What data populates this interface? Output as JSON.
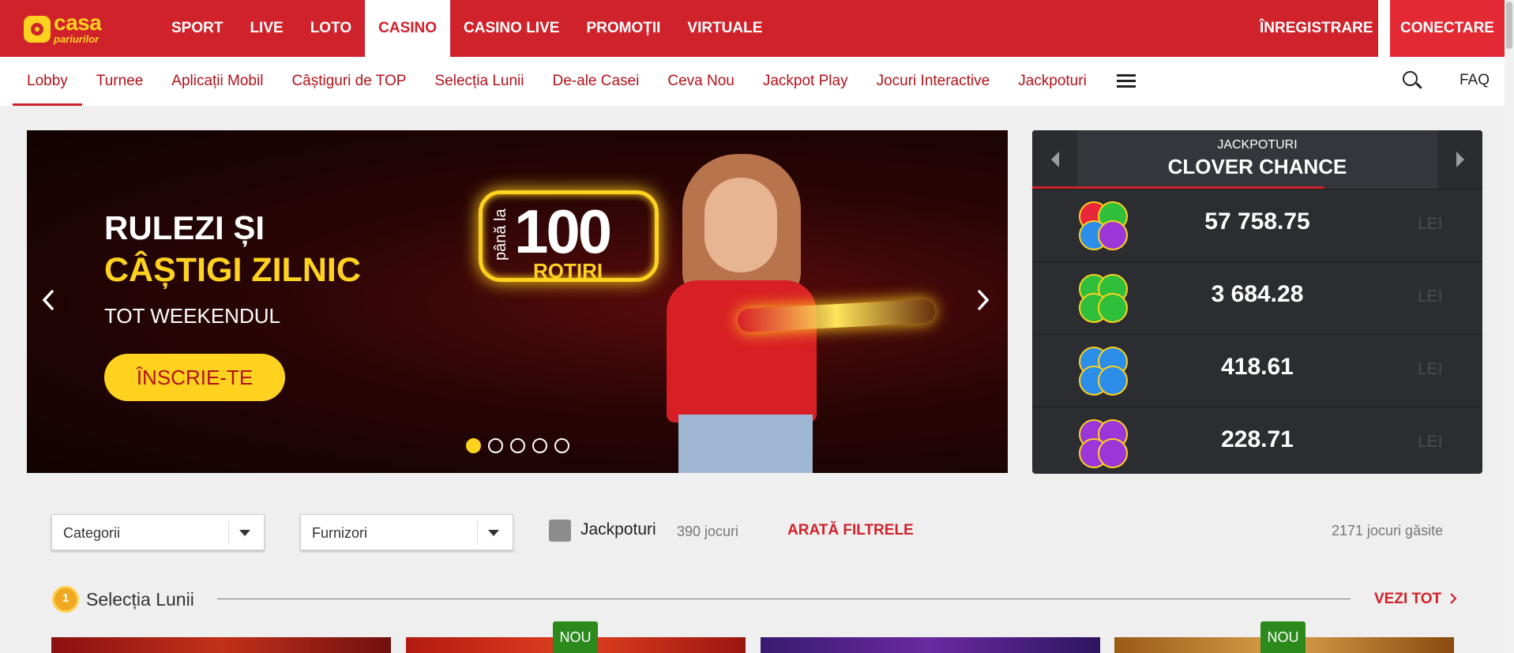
{
  "brand": {
    "logo_text": "casa",
    "logo_sub": "pariurilor"
  },
  "topnav": {
    "items": [
      {
        "label": "SPORT",
        "active": false
      },
      {
        "label": "LIVE",
        "active": false
      },
      {
        "label": "LOTO",
        "active": false
      },
      {
        "label": "CASINO",
        "active": true
      },
      {
        "label": "CASINO LIVE",
        "active": false
      },
      {
        "label": "PROMOȚII",
        "active": false
      },
      {
        "label": "VIRTUALE",
        "active": false
      }
    ],
    "register": "ÎNREGISTRARE",
    "connect": "CONECTARE"
  },
  "subnav": {
    "items": [
      {
        "label": "Lobby",
        "active": true
      },
      {
        "label": "Turnee",
        "active": false
      },
      {
        "label": "Aplicații Mobil",
        "active": false
      },
      {
        "label": "Câștiguri de TOP",
        "active": false
      },
      {
        "label": "Selecția Lunii",
        "active": false
      },
      {
        "label": "De-ale Casei",
        "active": false
      },
      {
        "label": "Ceva Nou",
        "active": false
      },
      {
        "label": "Jackpot Play",
        "active": false
      },
      {
        "label": "Jocuri Interactive",
        "active": false
      },
      {
        "label": "Jackpoturi",
        "active": false
      }
    ],
    "menu_icon": "hamburger-icon",
    "search_icon": "search-icon",
    "faq": "FAQ"
  },
  "hero": {
    "line1": "RULEZI ȘI",
    "line2": "CÂȘTIGI ZILNIC",
    "line3": "TOT WEEKENDUL",
    "cta": "ÎNSCRIE-TE",
    "promo_prefix": "până la",
    "promo_number": "100",
    "promo_unit": "ROTIRI",
    "slides_total": 5,
    "active_slide": 1
  },
  "jackpot": {
    "label": "JACKPOTURI",
    "title": "CLOVER CHANCE",
    "currency": "LEI",
    "tiers": [
      {
        "amount": "57 758.75",
        "color": "multi"
      },
      {
        "amount": "3 684.28",
        "color": "#2fbf3a"
      },
      {
        "amount": "418.61",
        "color": "#2c8ee8"
      },
      {
        "amount": "228.71",
        "color": "#9b37d8"
      }
    ]
  },
  "filters": {
    "categories": "Categorii",
    "providers": "Furnizori",
    "jackpot_label": "Jackpoturi",
    "jackpot_count": "390 jocuri",
    "show_filters": "ARATĂ FILTRELE",
    "found": "2171 jocuri găsite"
  },
  "section": {
    "medal": "1",
    "title": "Selecția Lunii",
    "see_all": "VEZI TOT",
    "new_badge": "NOU"
  },
  "colors": {
    "brand_red": "#d0222b",
    "accent_yellow": "#ffd21f",
    "new_green": "#2c8a1d"
  }
}
